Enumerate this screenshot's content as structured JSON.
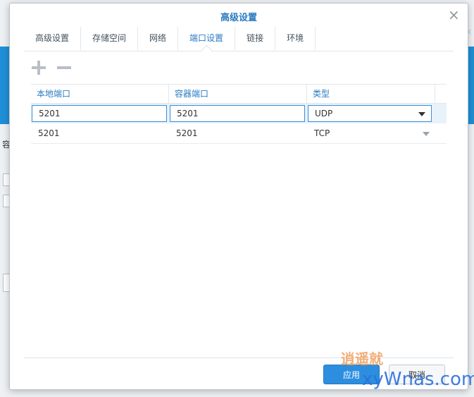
{
  "dialog": {
    "title": "高级设置",
    "close_symbol": "×"
  },
  "tabs": [
    {
      "label": "高级设置",
      "active": false
    },
    {
      "label": "存储空间",
      "active": false
    },
    {
      "label": "网络",
      "active": false
    },
    {
      "label": "端口设置",
      "active": true
    },
    {
      "label": "链接",
      "active": false
    },
    {
      "label": "环境",
      "active": false
    }
  ],
  "toolbar": {
    "add_icon": "plus-icon",
    "remove_icon": "minus-icon"
  },
  "grid": {
    "columns": [
      "本地端口",
      "容器端口",
      "类型"
    ],
    "rows": [
      {
        "local_port": "5201",
        "container_port": "5201",
        "type": "UDP",
        "editing": true
      },
      {
        "local_port": "5201",
        "container_port": "5201",
        "type": "TCP",
        "editing": false
      }
    ]
  },
  "footer": {
    "apply_label": "应用",
    "cancel_label": "取消"
  },
  "watermark": {
    "cn": "逍遥就",
    "en": "xyWnas.com"
  },
  "background": {
    "fragment_char": "容"
  },
  "colors": {
    "accent": "#2a7bc0",
    "apply_button": "#2d8ee0",
    "edit_border": "#3a8fd6"
  }
}
